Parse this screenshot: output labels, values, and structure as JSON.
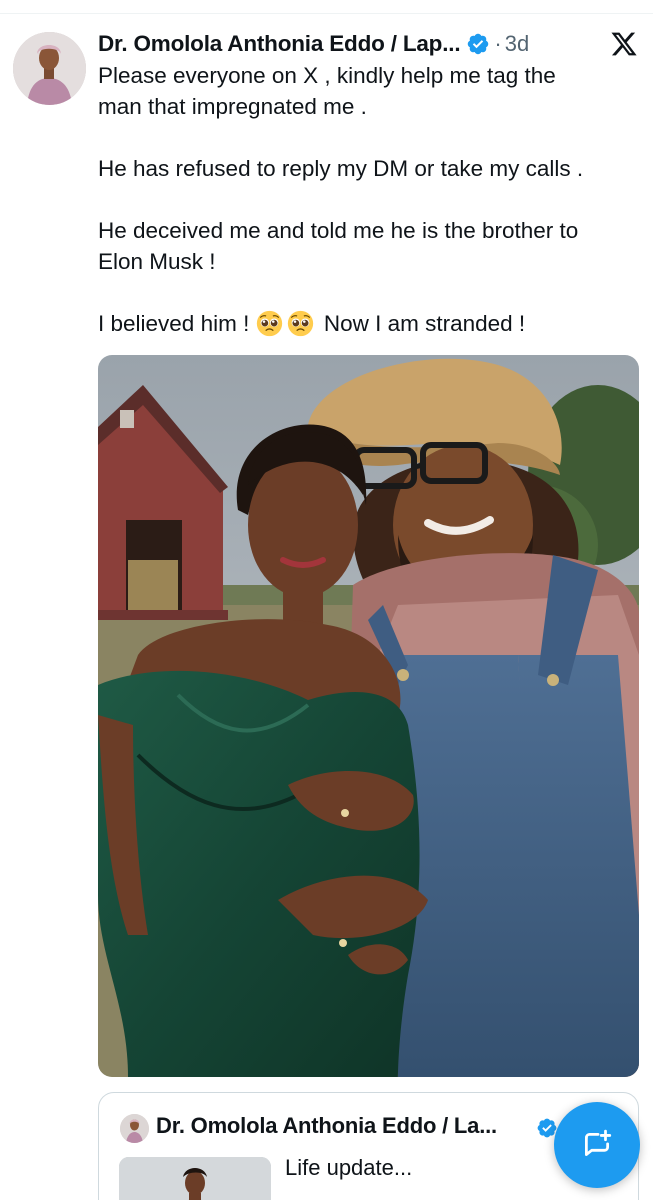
{
  "tweet": {
    "author_name": "Dr. Omolola Anthonia Eddo / Lap...",
    "separator": "·",
    "time": "3d",
    "paragraphs": [
      [
        "Please everyone on X , kindly help me tag  the",
        "man that impregnated me ."
      ],
      [
        "He has refused to reply my DM or take my calls ."
      ],
      [
        "He deceived me and told me he is the brother to",
        "Elon Musk !"
      ]
    ],
    "last_line": {
      "before_emoji": "I believed him ! ",
      "emoji_name": "pleading-face-emoji",
      "emoji_count": 2,
      "after_emoji": " Now I am stranded !"
    }
  },
  "quoted_tweet": {
    "author_name": "Dr. Omolola Anthonia Eddo / La...",
    "text": "Life update..."
  },
  "compose_button": {
    "icon": "compose-post-icon"
  },
  "icons": {
    "verified": "verified-badge-icon",
    "platform_logo": "x-logo-icon"
  },
  "colors": {
    "accent": "#1d9bf0",
    "text": "#0f1419",
    "secondary": "#536471",
    "border": "#cfd9de"
  }
}
